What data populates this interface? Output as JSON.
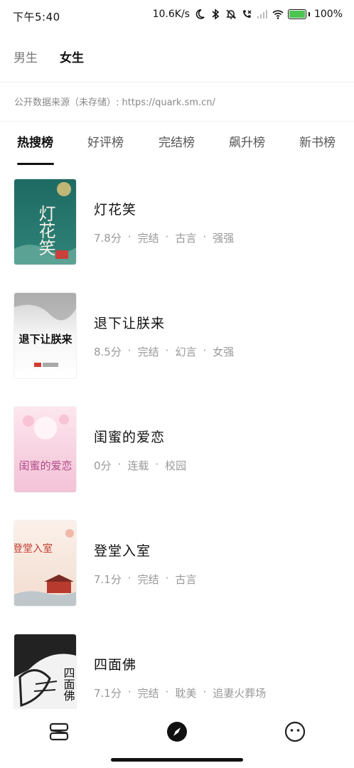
{
  "status": {
    "time": "下午5:40",
    "net_speed": "10.6K/s",
    "battery": "100%",
    "battery_level": 1.0
  },
  "gender_tabs": [
    {
      "label": "男生",
      "active": false
    },
    {
      "label": "女生",
      "active": true
    }
  ],
  "source_note": "公开数据来源（未存储）: https://quark.sm.cn/",
  "rank_tabs": [
    {
      "label": "热搜榜",
      "active": true
    },
    {
      "label": "好评榜",
      "active": false
    },
    {
      "label": "完结榜",
      "active": false
    },
    {
      "label": "飙升榜",
      "active": false
    },
    {
      "label": "新书榜",
      "active": false
    }
  ],
  "books": [
    {
      "title": "灯花笑",
      "score": "7.8分",
      "tags": [
        "完结",
        "古言",
        "强强"
      ],
      "cover_text": "灯花笑",
      "cover_colors": [
        "#1e6a63",
        "#2f8478"
      ]
    },
    {
      "title": "退下让朕来",
      "score": "8.5分",
      "tags": [
        "完结",
        "幻言",
        "女强"
      ],
      "cover_text": "退下让朕来",
      "cover_colors": [
        "#f4f4f4",
        "#d9d9d9"
      ]
    },
    {
      "title": "闺蜜的爱恋",
      "score": "0分",
      "tags": [
        "连载",
        "校园"
      ],
      "cover_text": "闺蜜的爱恋",
      "cover_colors": [
        "#fde6ee",
        "#f3c2d6"
      ]
    },
    {
      "title": "登堂入室",
      "score": "7.1分",
      "tags": [
        "完结",
        "古言"
      ],
      "cover_text": "登堂入室",
      "cover_colors": [
        "#fbf1ea",
        "#f2dccf"
      ]
    },
    {
      "title": "四面佛",
      "score": "7.1分",
      "tags": [
        "完结",
        "耽美",
        "追妻火葬场"
      ],
      "cover_text": "四面佛",
      "cover_colors": [
        "#f2f2f2",
        "#cfcfcf"
      ]
    }
  ],
  "bottom_nav": [
    {
      "icon": "bookshelf-icon",
      "active": false
    },
    {
      "icon": "compass-icon",
      "active": true
    },
    {
      "icon": "profile-icon",
      "active": false
    }
  ]
}
